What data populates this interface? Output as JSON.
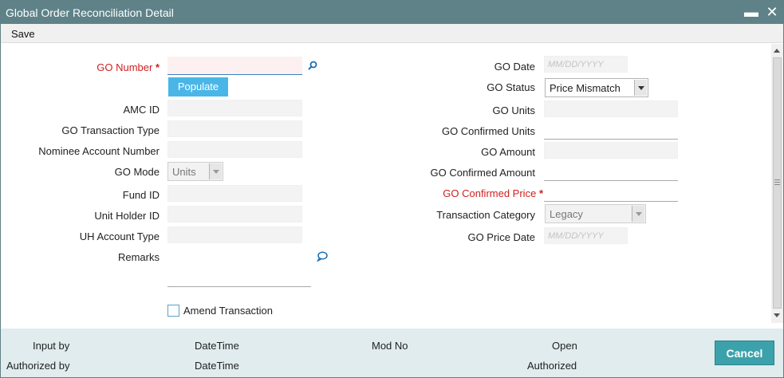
{
  "window": {
    "title": "Global Order Reconciliation Detail",
    "minimize_glyph": "▬",
    "close_glyph": "✕"
  },
  "toolbar": {
    "save_label": "Save"
  },
  "form_left": {
    "go_number_label": "GO Number",
    "go_number_value": "",
    "populate_label": "Populate",
    "amc_id_label": "AMC ID",
    "go_transaction_type_label": "GO Transaction Type",
    "nominee_account_number_label": "Nominee Account Number",
    "go_mode_label": "GO Mode",
    "go_mode_value": "Units",
    "fund_id_label": "Fund ID",
    "unit_holder_id_label": "Unit Holder ID",
    "uh_account_type_label": "UH Account Type",
    "remarks_label": "Remarks",
    "amend_transaction_label": "Amend Transaction"
  },
  "form_right": {
    "go_date_label": "GO Date",
    "go_date_placeholder": "MM/DD/YYYY",
    "go_status_label": "GO Status",
    "go_status_value": "Price Mismatch",
    "go_units_label": "GO Units",
    "go_confirmed_units_label": "GO Confirmed Units",
    "go_amount_label": "GO Amount",
    "go_confirmed_amount_label": "GO Confirmed Amount",
    "go_confirmed_price_label": "GO Confirmed Price",
    "transaction_category_label": "Transaction Category",
    "transaction_category_value": "Legacy",
    "go_price_date_label": "GO Price Date",
    "go_price_date_placeholder": "MM/DD/YYYY"
  },
  "required_mark": "*",
  "footer": {
    "input_by_label": "Input by",
    "authorized_by_label": "Authorized by",
    "datetime_label_1": "DateTime",
    "datetime_label_2": "DateTime",
    "mod_no_label": "Mod No",
    "open_label": "Open",
    "authorized_label": "Authorized",
    "cancel_label": "Cancel"
  },
  "colors": {
    "titlebar": "#5e8288",
    "required": "#d01f1f",
    "populate_button": "#4ab6e8",
    "cancel_button": "#3ba2ac",
    "footer": "#e0ecee",
    "icon_blue": "#1a6fb5"
  },
  "icons": {
    "go_number_lookup": "search-icon",
    "remarks_edit": "speech-bubble-icon"
  }
}
